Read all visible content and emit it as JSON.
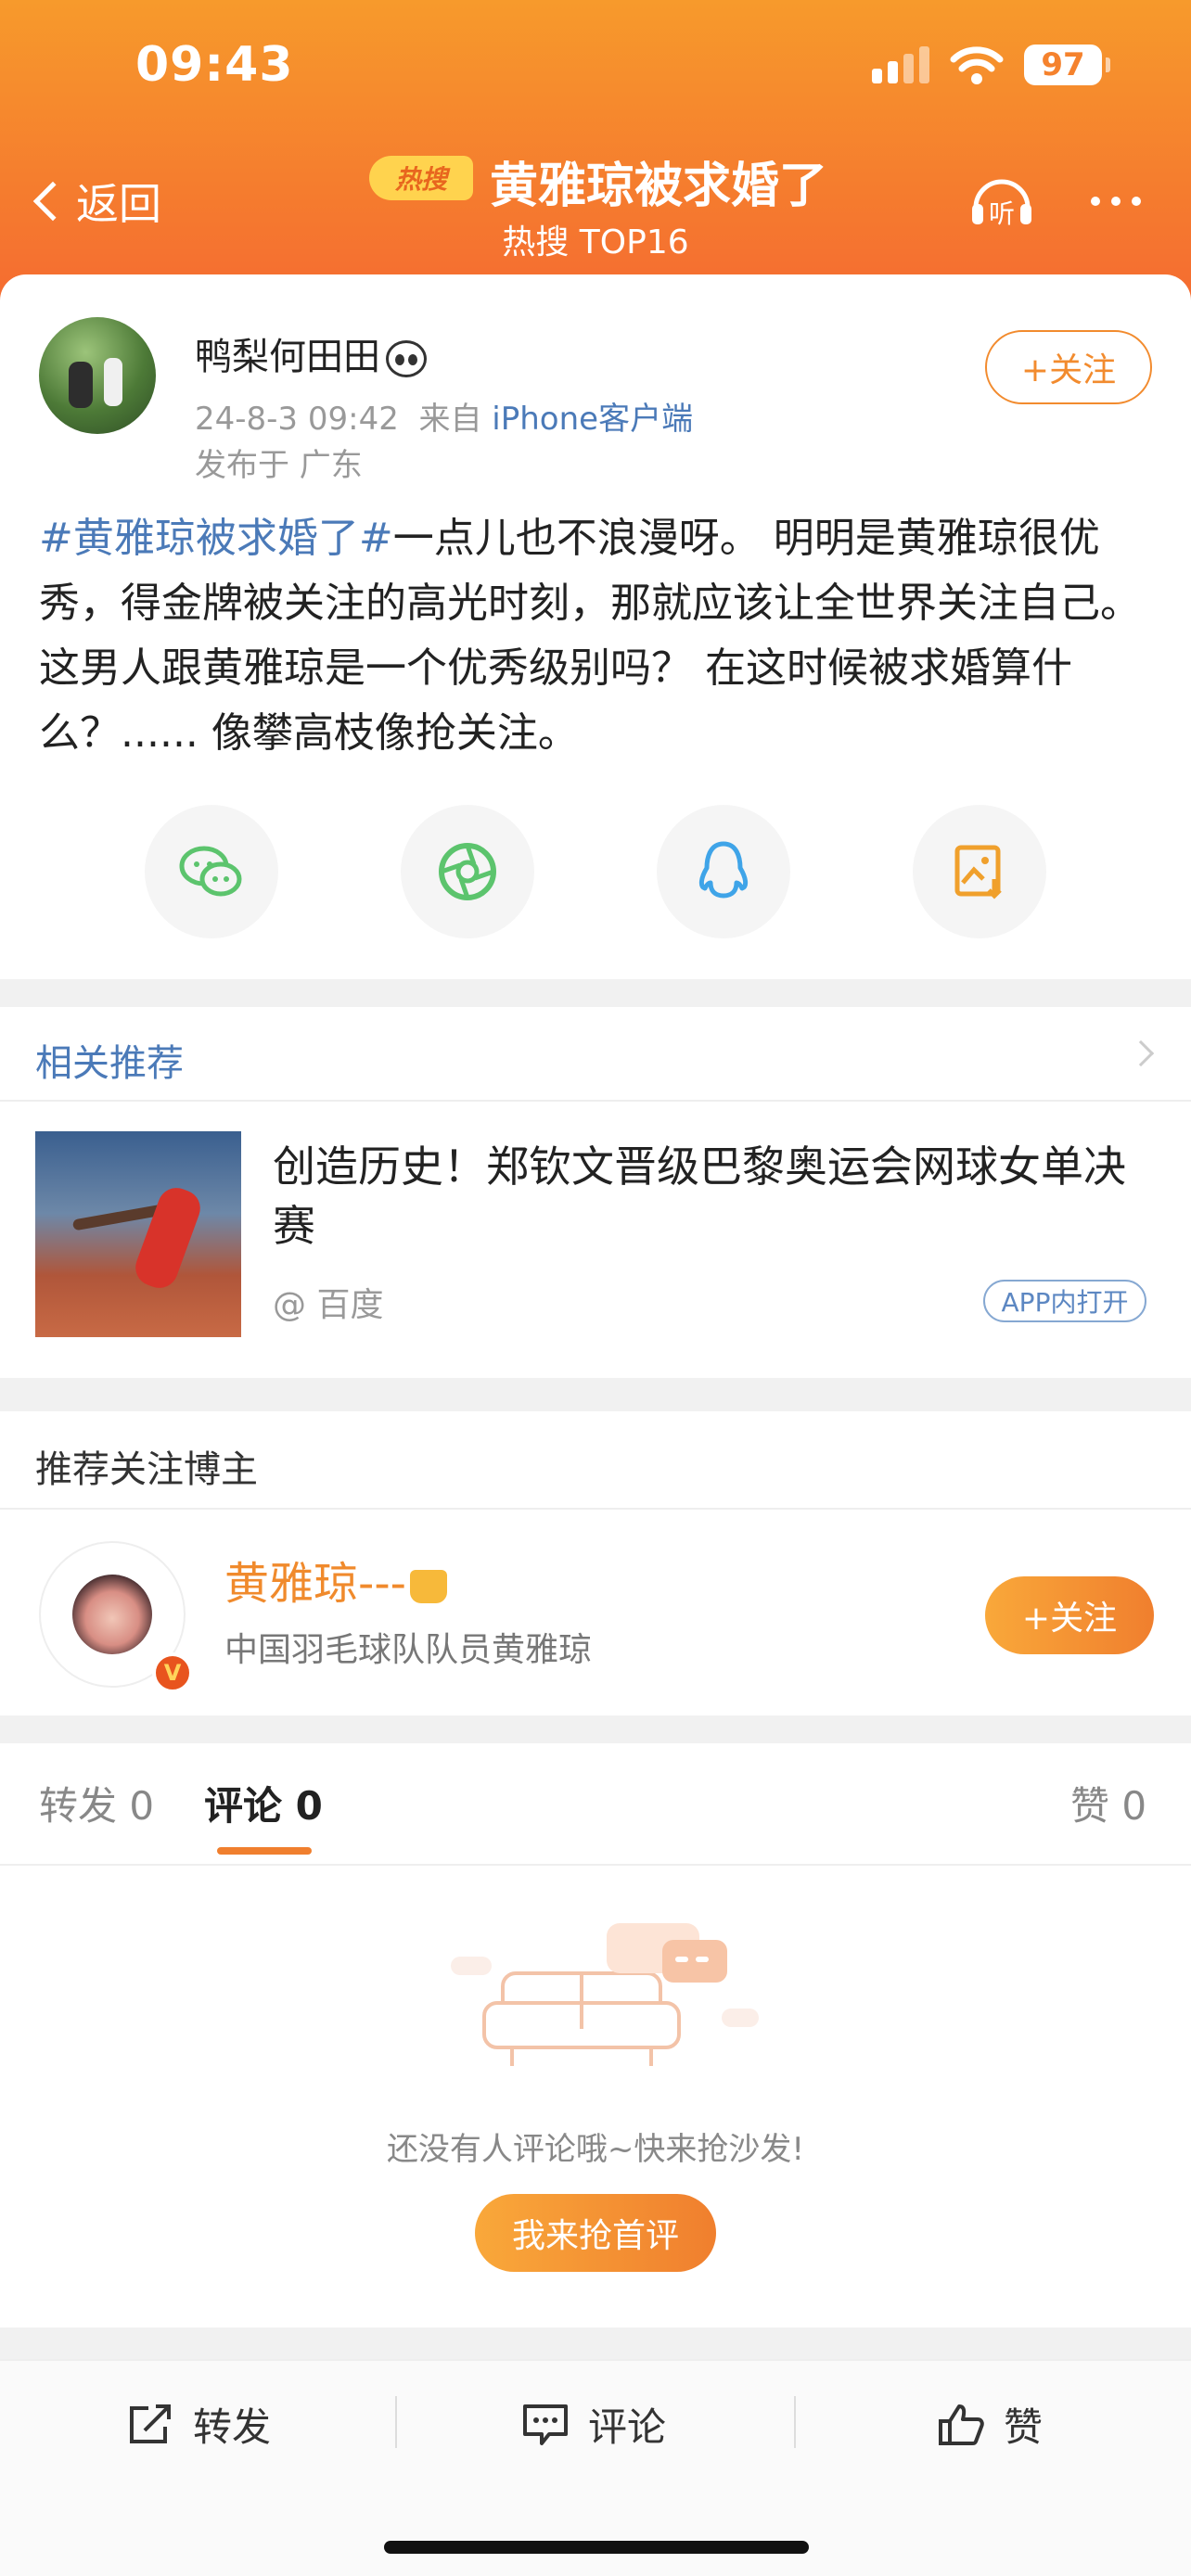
{
  "status_bar": {
    "time": "09:43",
    "battery": "97"
  },
  "nav": {
    "back_label": "返回",
    "hot_badge": "热搜",
    "title": "黄雅琼被求婚了",
    "subtitle": "热搜 TOP16",
    "listen_label": "听"
  },
  "post": {
    "username": "鸭梨何田田",
    "timestamp": "24-8-3 09:42",
    "from_prefix": "来自",
    "source": "iPhone客户端",
    "location": "发布于 广东",
    "follow_label": "+关注",
    "hashtag": "#黄雅琼被求婚了#",
    "body": "一点儿也不浪漫呀。 明明是黄雅琼很优秀，得金牌被关注的高光时刻，那就应该让全世界关注自己。 这男人跟黄雅琼是一个优秀级别吗？ 在这时候被求婚算什么？...... 像攀高枝像抢关注。"
  },
  "related": {
    "heading": "相关推荐",
    "title": "创造历史！郑钦文晋级巴黎奥运会网球女单决赛",
    "source": "@ 百度",
    "app_open_label": "APP内打开"
  },
  "blogger": {
    "heading": "推荐关注博主",
    "name": "黄雅琼---",
    "description": "中国羽毛球队队员黄雅琼",
    "badge": "V",
    "follow_label": "+关注"
  },
  "comments": {
    "tabs": {
      "repost": {
        "label": "转发",
        "count": "0"
      },
      "comment": {
        "label": "评论",
        "count": "0"
      },
      "like": {
        "label": "赞",
        "count": "0"
      }
    },
    "empty_text": "还没有人评论哦~快来抢沙发!",
    "first_button": "我来抢首评"
  },
  "bottom_bar": {
    "repost": "转发",
    "comment": "评论",
    "like": "赞"
  },
  "colors": {
    "accent": "#f07f2e",
    "link": "#4b7ab8",
    "header_top": "#f79a2c",
    "header_bottom": "#f56b31"
  }
}
